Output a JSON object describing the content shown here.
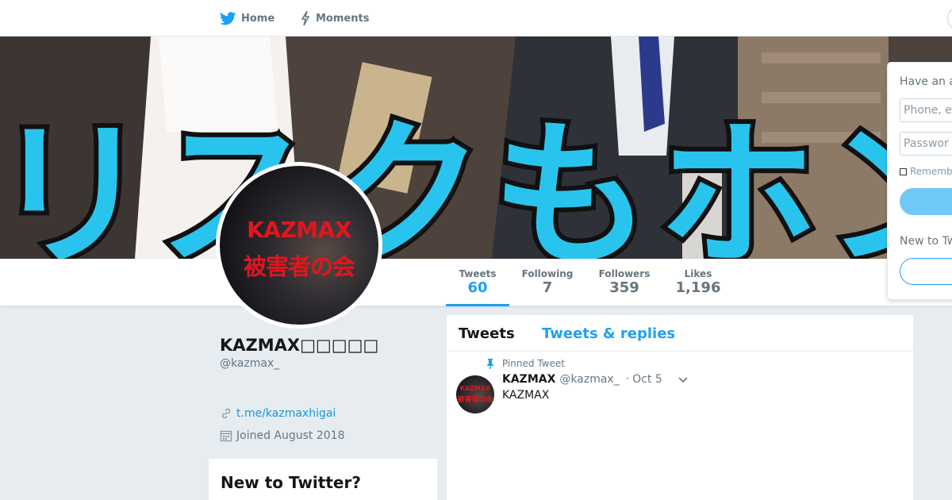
{
  "nav": {
    "home_label": "Home",
    "moments_label": "Moments"
  },
  "banner": {
    "overlay_text": "リスクもホン"
  },
  "profile": {
    "avatar_line1": "KAZMAX",
    "avatar_line2": "被害者の会",
    "display_name": "KAZMAX□□□□□",
    "handle": "@kazmax_",
    "link": "t.me/kazmaxhigai",
    "joined": "Joined August 2018"
  },
  "stats": [
    {
      "label": "Tweets",
      "value": "60"
    },
    {
      "label": "Following",
      "value": "7"
    },
    {
      "label": "Followers",
      "value": "359"
    },
    {
      "label": "Likes",
      "value": "1,196"
    }
  ],
  "timeline": {
    "tabs": [
      "Tweets",
      "Tweets & replies"
    ],
    "pinned_label": "Pinned Tweet",
    "tweet": {
      "name": "KAZMAX",
      "handle": "@kazmax_",
      "separator": "·",
      "time": "Oct 5",
      "text": "KAZMAX",
      "avatar_line1": "KAZMAX",
      "avatar_line2": "被害者の会"
    }
  },
  "sidebar_left": {
    "new_to_twitter": "New to Twitter?"
  },
  "login": {
    "title": "Have an a",
    "phone_placeholder": "Phone, e",
    "password_placeholder": "Passwor",
    "remember": "Rememb",
    "new_to": "New to Tw"
  },
  "colors": {
    "accent": "#1da1f2",
    "link": "#1b95e0",
    "banner_text": "#29c4ee",
    "avatar_text": "#e0161e",
    "background": "#e6ecf0"
  }
}
